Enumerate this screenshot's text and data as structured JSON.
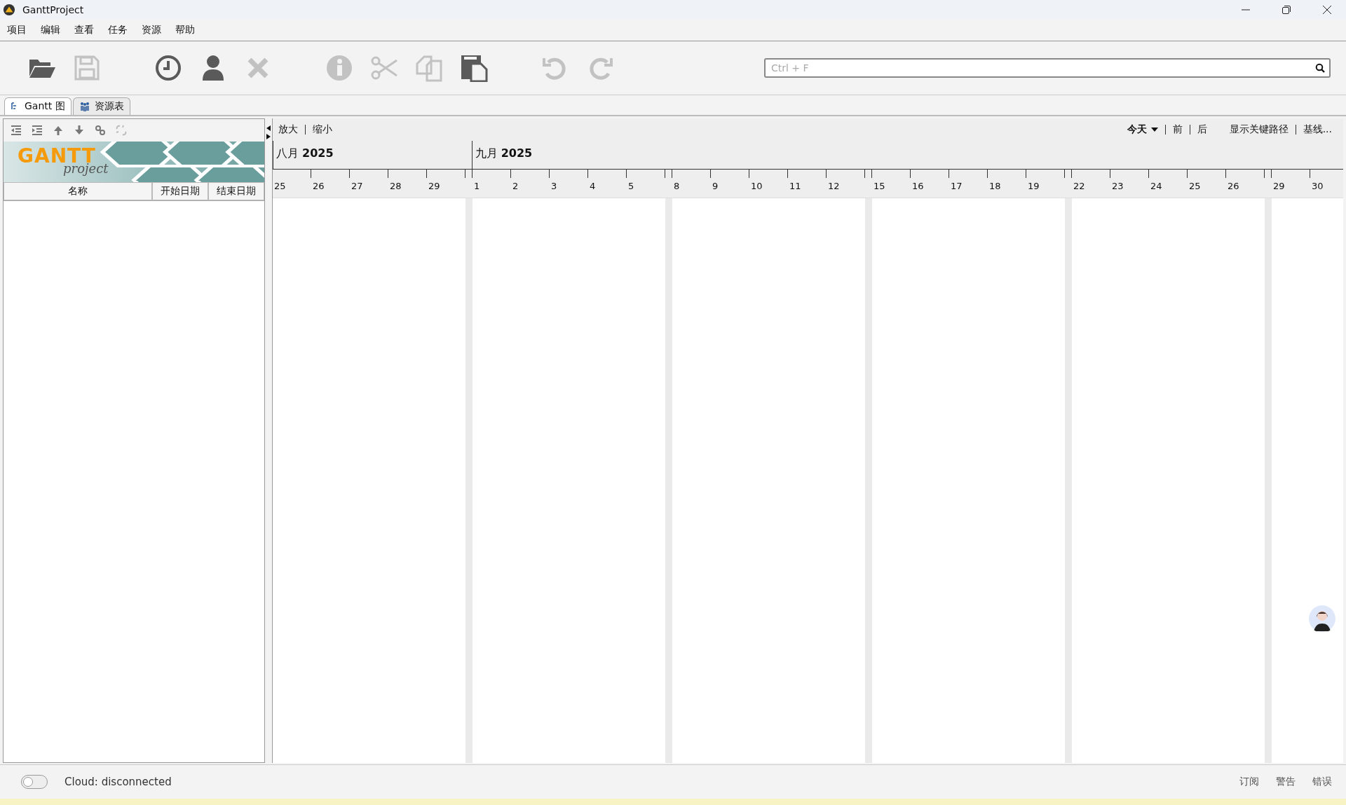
{
  "window": {
    "title": "GanttProject"
  },
  "menu": [
    "项目",
    "编辑",
    "查看",
    "任务",
    "资源",
    "帮助"
  ],
  "toolbar": [
    {
      "kind": "open",
      "disabled": false
    },
    {
      "kind": "save",
      "disabled": true
    },
    {
      "kind": "sep"
    },
    {
      "kind": "clock",
      "disabled": false
    },
    {
      "kind": "person",
      "disabled": false
    },
    {
      "kind": "delete",
      "disabled": true
    },
    {
      "kind": "sep"
    },
    {
      "kind": "info",
      "disabled": true
    },
    {
      "kind": "cut",
      "disabled": true
    },
    {
      "kind": "copy",
      "disabled": true
    },
    {
      "kind": "paste",
      "disabled": false
    },
    {
      "kind": "sep"
    },
    {
      "kind": "undo",
      "disabled": true
    },
    {
      "kind": "redo",
      "disabled": true
    }
  ],
  "search": {
    "placeholder": "Ctrl + F"
  },
  "tabs": [
    {
      "label": "Gantt 图",
      "kind": "gantt",
      "selected": true
    },
    {
      "label": "资源表",
      "kind": "resources",
      "selected": false
    }
  ],
  "task_tools": [
    {
      "kind": "outdent",
      "disabled": false
    },
    {
      "kind": "indent",
      "disabled": false
    },
    {
      "kind": "up",
      "disabled": false
    },
    {
      "kind": "down",
      "disabled": false
    },
    {
      "kind": "link",
      "disabled": false
    },
    {
      "kind": "unlink",
      "disabled": true
    }
  ],
  "logo": {
    "title": "GANTT",
    "subtitle": "project"
  },
  "columns": [
    "名称",
    "开始日期",
    "结束日期"
  ],
  "zoom": [
    "放大",
    "缩小"
  ],
  "nav": {
    "today": "今天",
    "prev": "前",
    "next": "后",
    "critical_path": "显示关键路径",
    "baseline": "基线..."
  },
  "months": [
    {
      "label": "八月 **2025**",
      "days": [
        {
          "kind": "day",
          "label": "25"
        },
        {
          "kind": "day",
          "label": "26"
        },
        {
          "kind": "day",
          "label": "27"
        },
        {
          "kind": "day",
          "label": "28"
        },
        {
          "kind": "day",
          "label": "29"
        },
        {
          "kind": "weekend"
        }
      ]
    },
    {
      "label": "九月 **2025**",
      "days": [
        {
          "kind": "day",
          "label": "1"
        },
        {
          "kind": "day",
          "label": "2"
        },
        {
          "kind": "day",
          "label": "3"
        },
        {
          "kind": "day",
          "label": "4"
        },
        {
          "kind": "day",
          "label": "5"
        },
        {
          "kind": "weekend"
        },
        {
          "kind": "day",
          "label": "8"
        },
        {
          "kind": "day",
          "label": "9"
        },
        {
          "kind": "day",
          "label": "10"
        },
        {
          "kind": "day",
          "label": "11"
        },
        {
          "kind": "day",
          "label": "12"
        },
        {
          "kind": "weekend"
        },
        {
          "kind": "day",
          "label": "15"
        },
        {
          "kind": "day",
          "label": "16"
        },
        {
          "kind": "day",
          "label": "17"
        },
        {
          "kind": "day",
          "label": "18"
        },
        {
          "kind": "day",
          "label": "19"
        },
        {
          "kind": "weekend"
        },
        {
          "kind": "day",
          "label": "22"
        },
        {
          "kind": "day",
          "label": "23"
        },
        {
          "kind": "day",
          "label": "24"
        },
        {
          "kind": "day",
          "label": "25"
        },
        {
          "kind": "day",
          "label": "26"
        },
        {
          "kind": "weekend"
        },
        {
          "kind": "day",
          "label": "29"
        },
        {
          "kind": "day",
          "label": "30"
        }
      ]
    }
  ],
  "status_bar": {
    "cloud_on": false,
    "cloud": "Cloud: disconnected",
    "items": [
      "订阅",
      "警告",
      "错误"
    ]
  }
}
